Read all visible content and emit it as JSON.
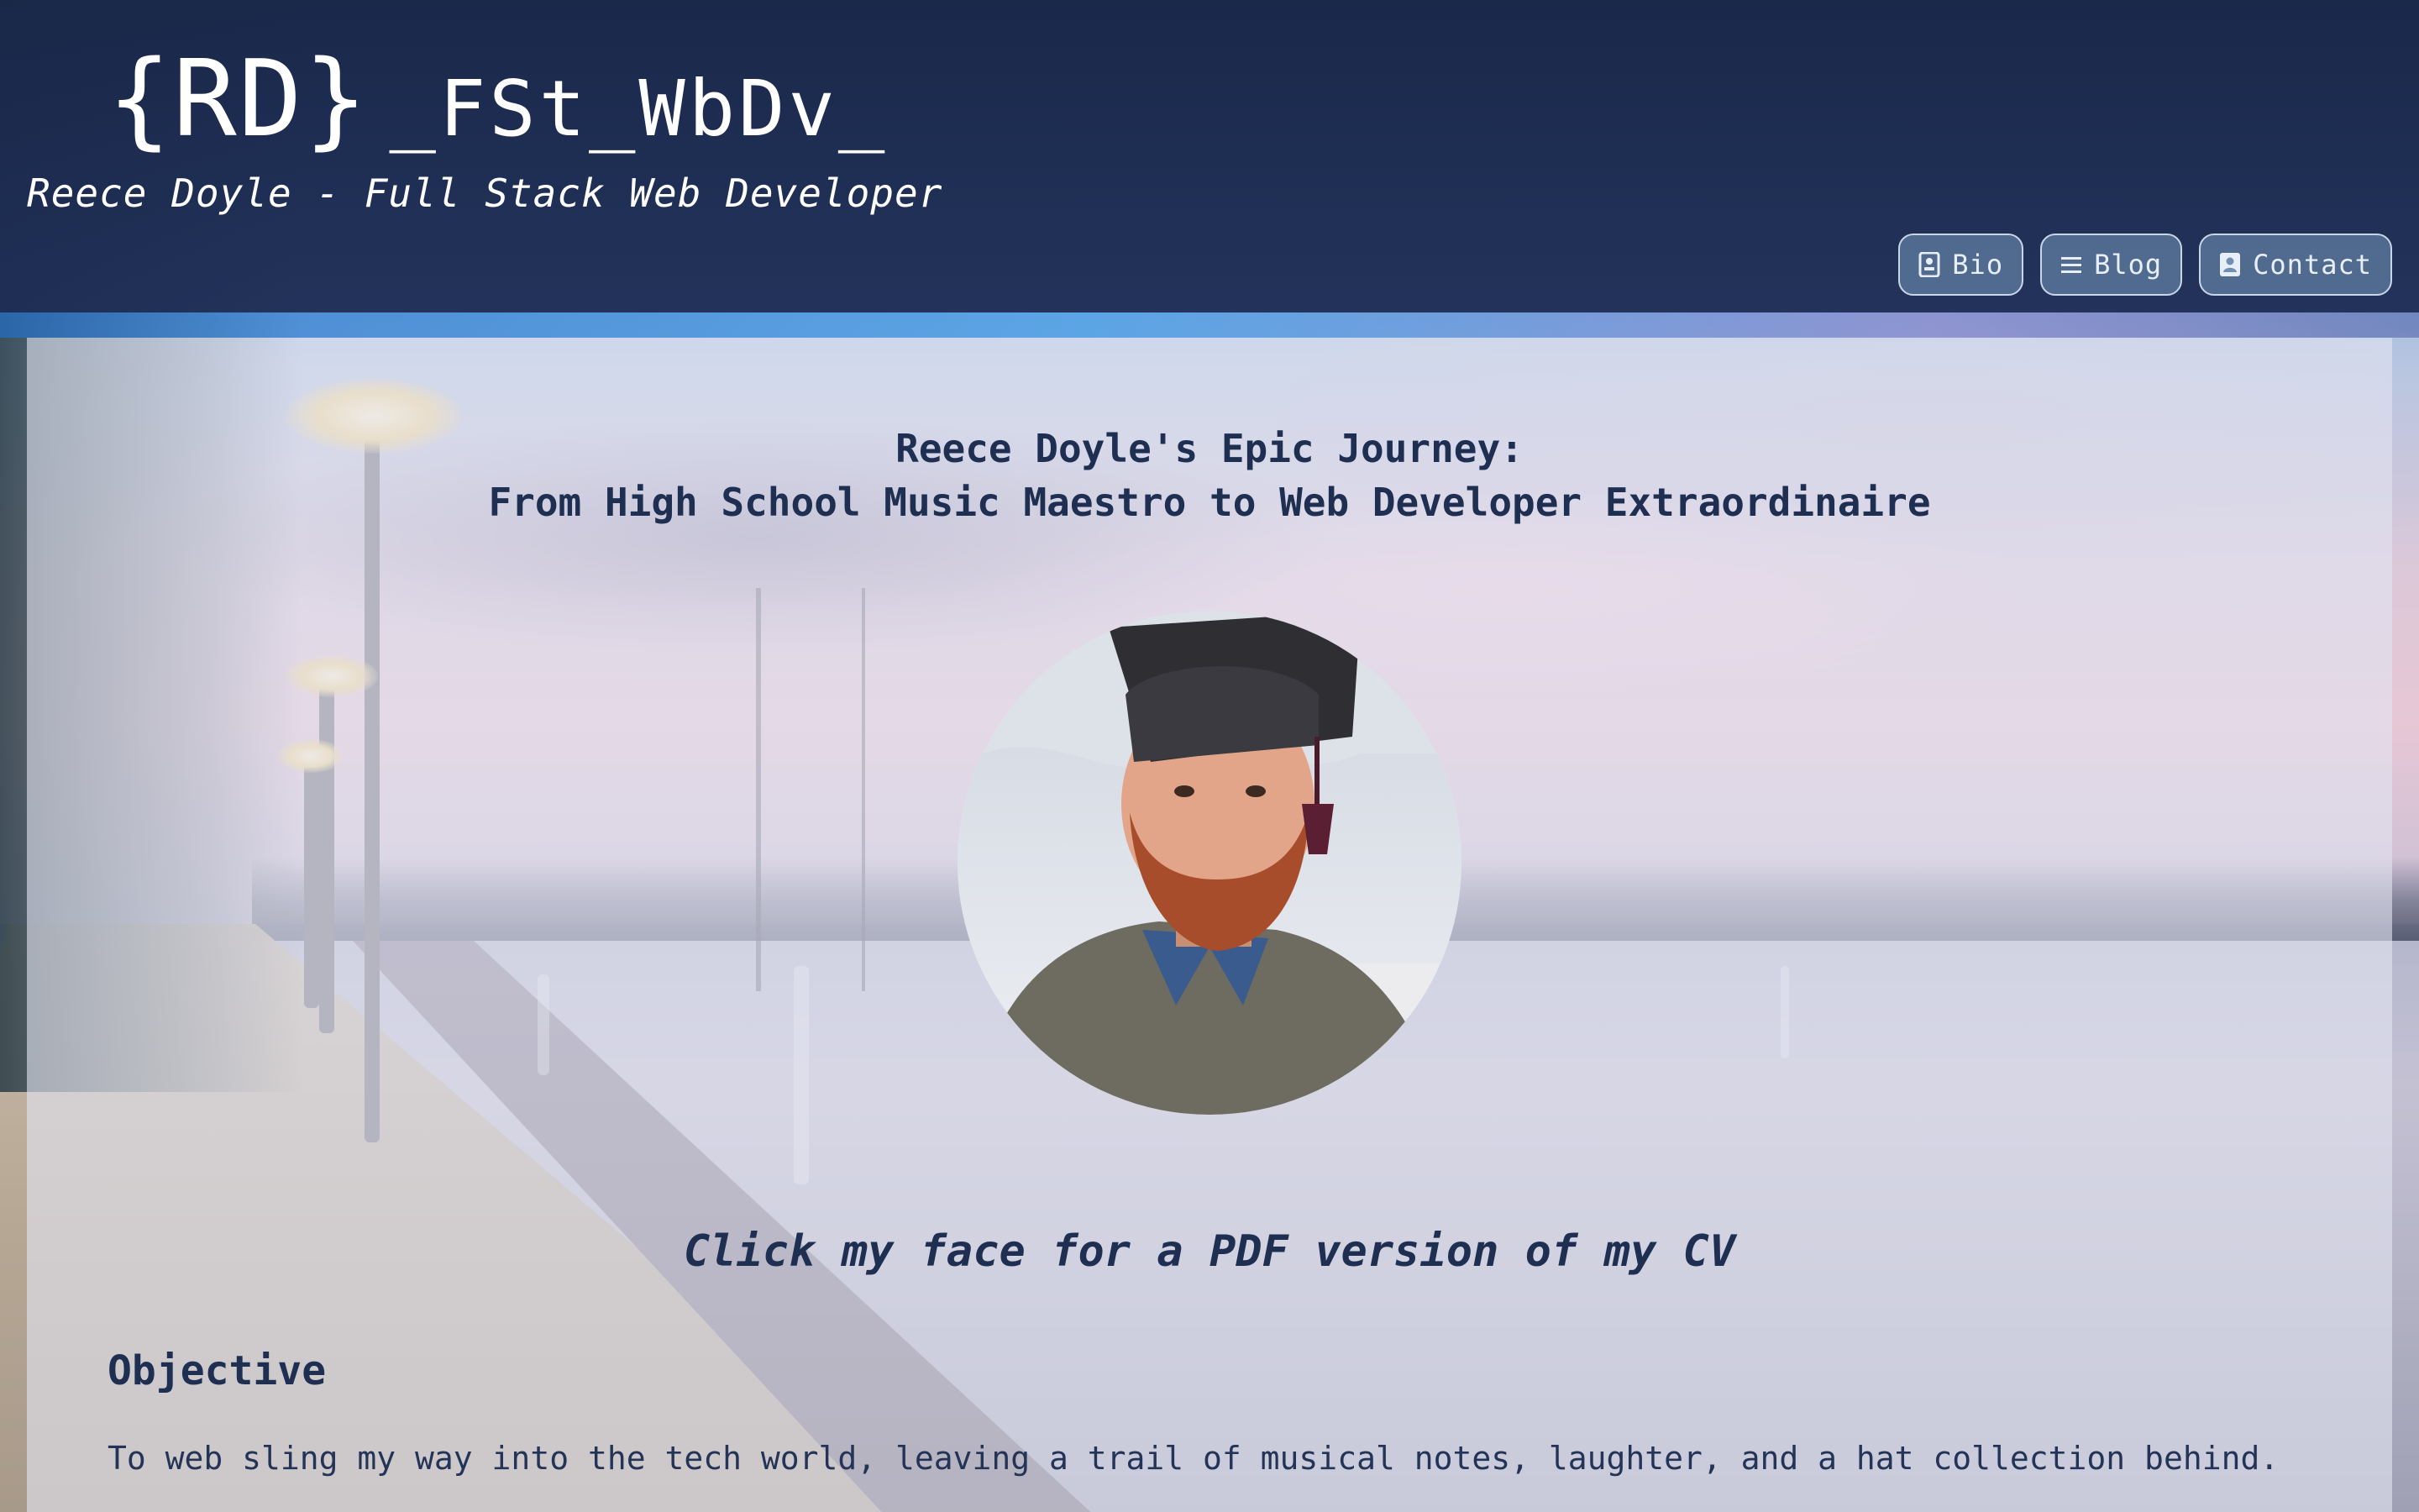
{
  "header": {
    "logo_mark": "{RD}",
    "logo_text": "_FSt_WbDv_",
    "tagline": "Reece Doyle - Full Stack Web Developer",
    "nav": [
      {
        "label": "Bio",
        "icon": "id-badge-icon"
      },
      {
        "label": "Blog",
        "icon": "list-icon"
      },
      {
        "label": "Contact",
        "icon": "address-book-icon"
      }
    ]
  },
  "main": {
    "headline_line1": "Reece Doyle's Epic Journey:",
    "headline_line2": "From High School Music Maestro to Web Developer Extraordinaire",
    "cv_link": "Click my face for a PDF version of my CV",
    "objective": {
      "title": "Objective",
      "body": "To web sling my way into the tech world, leaving a trail of musical notes, laughter, and a hat collection behind."
    }
  },
  "colors": {
    "header_bg": "#1e2d55",
    "text_dark": "#1f2f52",
    "nav_border": "#c9d6e8"
  }
}
